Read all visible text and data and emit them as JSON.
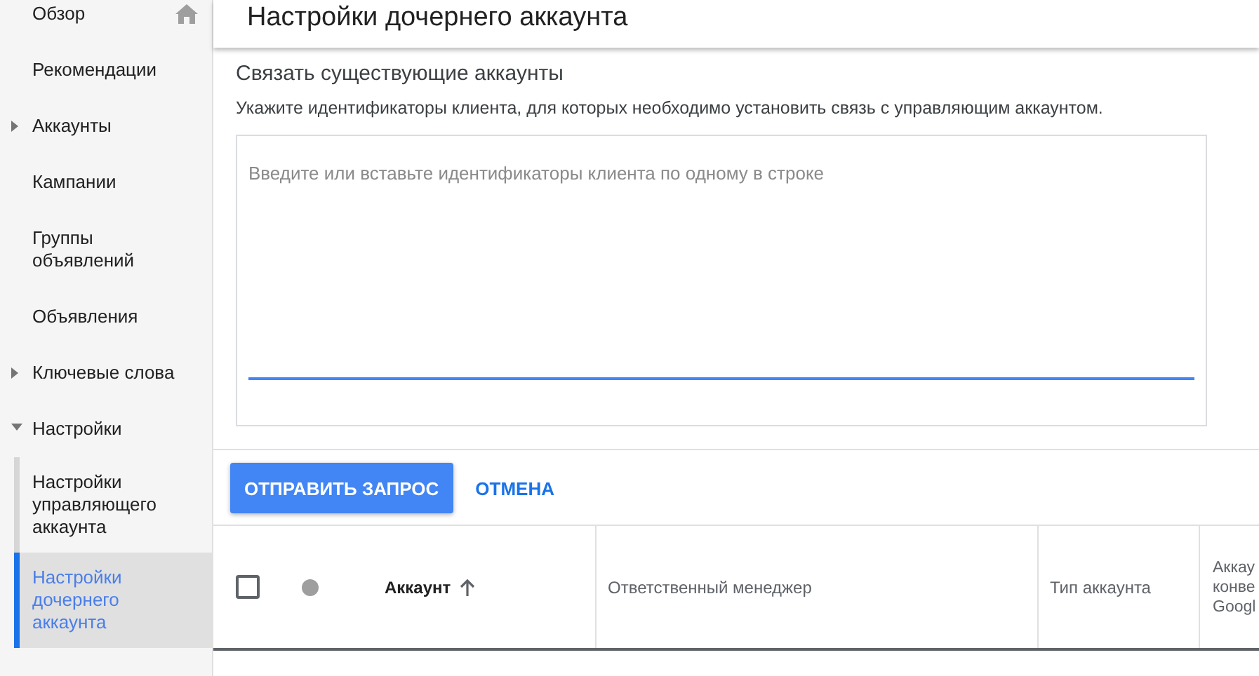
{
  "sidebar": {
    "items": [
      {
        "label": "Обзор",
        "kind": "home",
        "selected": false
      },
      {
        "label": "Рекомендации",
        "kind": "plain",
        "selected": false
      },
      {
        "label": "Аккаунты",
        "kind": "group",
        "expanded": false,
        "selected": false
      },
      {
        "label": "Кампании",
        "kind": "plain",
        "selected": false
      },
      {
        "label": "Группы объявлений",
        "kind": "plain",
        "selected": false
      },
      {
        "label": "Объявления",
        "kind": "plain",
        "selected": false
      },
      {
        "label": "Ключевые слова",
        "kind": "group",
        "expanded": false,
        "selected": false
      },
      {
        "label": "Настройки",
        "kind": "group",
        "expanded": true,
        "selected": false,
        "children": [
          {
            "label": "Настройки управляющего аккаунта",
            "selected": false
          },
          {
            "label": "Настройки дочернего аккаунта",
            "selected": true
          }
        ]
      }
    ]
  },
  "page": {
    "title": "Настройки дочернего аккаунта"
  },
  "link_section": {
    "heading": "Связать существующие аккаунты",
    "description": "Укажите идентификаторы клиента, для которых необходимо установить связь с управляющим аккаунтом.",
    "field": {
      "placeholder": "Введите или вставьте идентификаторы клиента по одному в строке"
    }
  },
  "buttons": [
    {
      "label": "ОТПРАВИТЬ ЗАПРОС",
      "kind": "primary"
    },
    {
      "label": "ОТМЕНА",
      "kind": "text"
    }
  ],
  "table": {
    "select_all": {
      "checked": false
    },
    "columns": [
      {
        "label": "Аккаунт",
        "sorted": true
      },
      {
        "label": "Ответственный менеджер",
        "sorted": false
      },
      {
        "label": "Тип аккаунта",
        "sorted": false
      },
      {
        "label": "Аккау конве Googl",
        "sorted": false
      }
    ]
  }
}
